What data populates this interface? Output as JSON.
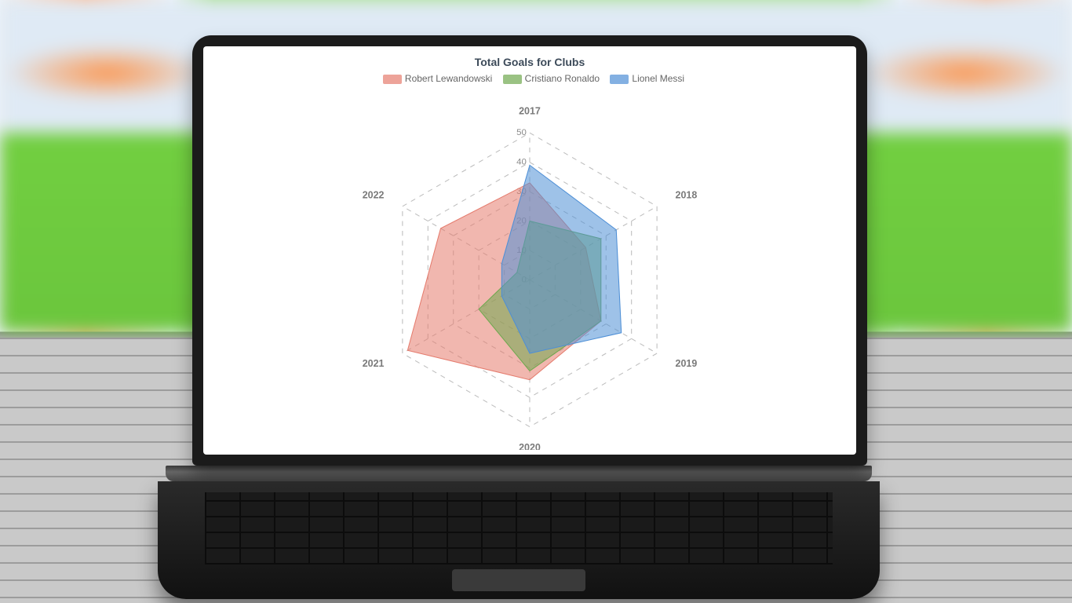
{
  "chart_data": {
    "type": "radar",
    "title": "Total Goals for Clubs",
    "categories": [
      "2017",
      "2018",
      "2019",
      "2020",
      "2021",
      "2022"
    ],
    "rmax": 50,
    "ticks": [
      0,
      10,
      20,
      30,
      40,
      50
    ],
    "legend_position": "top",
    "series": [
      {
        "name": "Robert Lewandowski",
        "color": "#e57c6e",
        "values": [
          33,
          22,
          28,
          34,
          48,
          35
        ]
      },
      {
        "name": "Cristiano Ronaldo",
        "color": "#6fa84f",
        "values": [
          20,
          28,
          28,
          31,
          20,
          5
        ]
      },
      {
        "name": "Lionel Messi",
        "color": "#4e8fd6",
        "values": [
          39,
          34,
          36,
          25,
          11,
          11
        ]
      }
    ]
  }
}
